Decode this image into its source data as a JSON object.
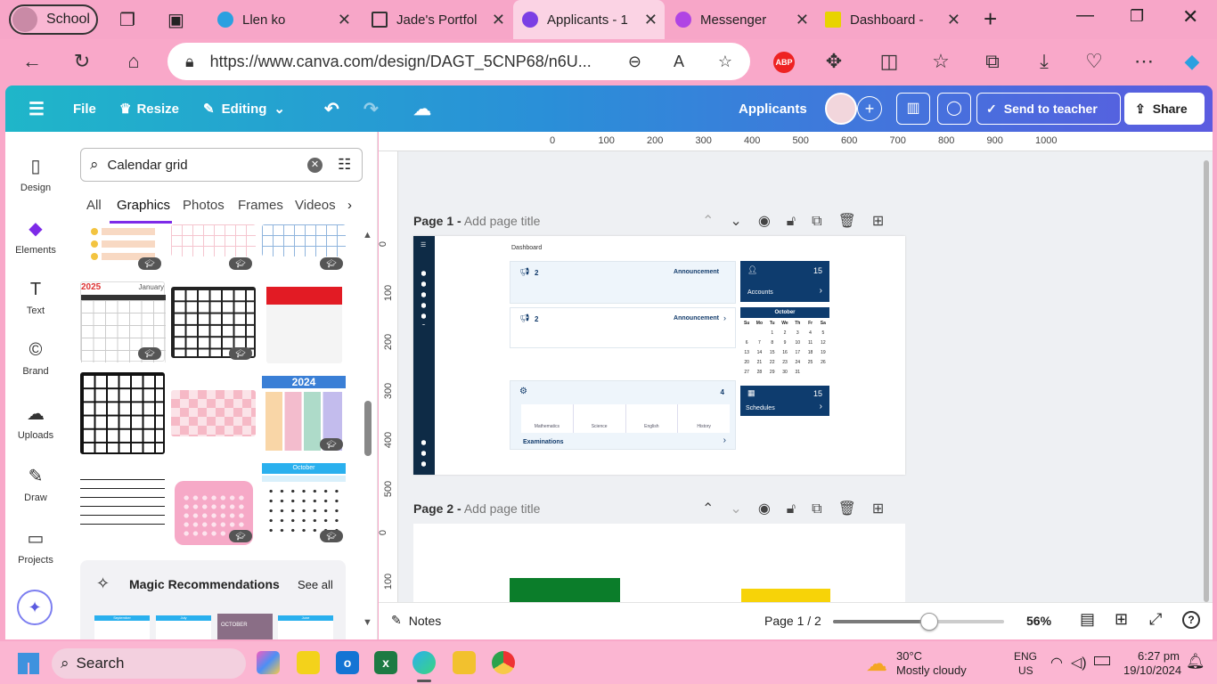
{
  "tabs": [
    {
      "label": "School",
      "color": "#e27aa6"
    },
    {
      "label": "Llen ko",
      "color": "#2aa0e0"
    },
    {
      "label": "Jade's Portfol",
      "color": "#555"
    },
    {
      "label": "Applicants - 1",
      "color": "#7b3fe4"
    },
    {
      "label": "Messenger",
      "color": "#b044e4"
    },
    {
      "label": "Dashboard - ",
      "color": "#e8d300"
    }
  ],
  "address": {
    "url": "https://www.canva.com/design/DAGT_5CNP68/n6U..."
  },
  "browser_icons": {
    "abp": "ABP"
  },
  "header": {
    "file": "File",
    "resize": "Resize",
    "editing": "Editing",
    "title": "Applicants",
    "send": "Send to teacher",
    "share": "Share"
  },
  "rail": [
    {
      "icon": "design-icon",
      "label": "Design",
      "glyph": "▯"
    },
    {
      "icon": "elements-icon",
      "label": "Elements",
      "glyph": "◆"
    },
    {
      "icon": "text-icon",
      "label": "Text",
      "glyph": "T"
    },
    {
      "icon": "brand-icon",
      "label": "Brand",
      "glyph": "©"
    },
    {
      "icon": "uploads-icon",
      "label": "Uploads",
      "glyph": "☁"
    },
    {
      "icon": "draw-icon",
      "label": "Draw",
      "glyph": "✎"
    },
    {
      "icon": "projects-icon",
      "label": "Projects",
      "glyph": "▭"
    }
  ],
  "panel": {
    "search_value": "Calendar grid",
    "tabs": [
      "All",
      "Graphics",
      "Photos",
      "Frames",
      "Videos"
    ],
    "active_tab": "Graphics",
    "thumb_text": {
      "year2025": "2025",
      "january": "January",
      "year2024": "2024",
      "october": "October"
    },
    "magic": {
      "title": "Magic Recommendations",
      "see_all": "See all"
    },
    "magic_thumbs": [
      "September",
      "July",
      "OCTOBER",
      "June"
    ]
  },
  "ruler": {
    "h": [
      "0",
      "100",
      "200",
      "300",
      "400",
      "500",
      "600",
      "700",
      "800",
      "900",
      "1000"
    ],
    "v": [
      "0",
      "100",
      "200",
      "300",
      "400",
      "500"
    ],
    "v2": [
      "0",
      "100"
    ]
  },
  "pages": [
    {
      "num": "Page 1 -",
      "title": "Add page title"
    },
    {
      "num": "Page 2 -",
      "title": "Add page title"
    }
  ],
  "dashboard": {
    "title": "Dashboard",
    "card1": {
      "num": "2",
      "label": "Announcement"
    },
    "card2": {
      "num": "2",
      "label": "Announcement"
    },
    "accounts": {
      "num": "15",
      "label": "Accounts"
    },
    "calendar": {
      "month": "October",
      "days": [
        "Su",
        "Mo",
        "Tu",
        "We",
        "Th",
        "Fr",
        "Sa"
      ],
      "dates": [
        "",
        "",
        "1",
        "2",
        "3",
        "4",
        "5",
        "6",
        "7",
        "8",
        "9",
        "10",
        "11",
        "12",
        "13",
        "14",
        "15",
        "16",
        "17",
        "18",
        "19",
        "20",
        "21",
        "22",
        "23",
        "24",
        "25",
        "26",
        "27",
        "28",
        "29",
        "30",
        "31",
        "",
        ""
      ]
    },
    "schedules": {
      "num": "15",
      "label": "Schedules"
    },
    "exam": {
      "num": "4",
      "subjects": [
        "Mathematics",
        "Science",
        "English",
        "History"
      ],
      "label": "Examinations"
    }
  },
  "bottom": {
    "notes": "Notes",
    "page": "Page 1 / 2",
    "zoom": "56%",
    "zoom_level": 0.56
  },
  "taskbar": {
    "search": "Search",
    "weather_temp": "30°C",
    "weather_desc": "Mostly cloudy",
    "lang1": "ENG",
    "lang2": "US",
    "time": "6:27 pm",
    "date": "19/10/2024"
  },
  "colors": {
    "accent": "#7d2ae8",
    "navy": "#0e3c6e"
  }
}
